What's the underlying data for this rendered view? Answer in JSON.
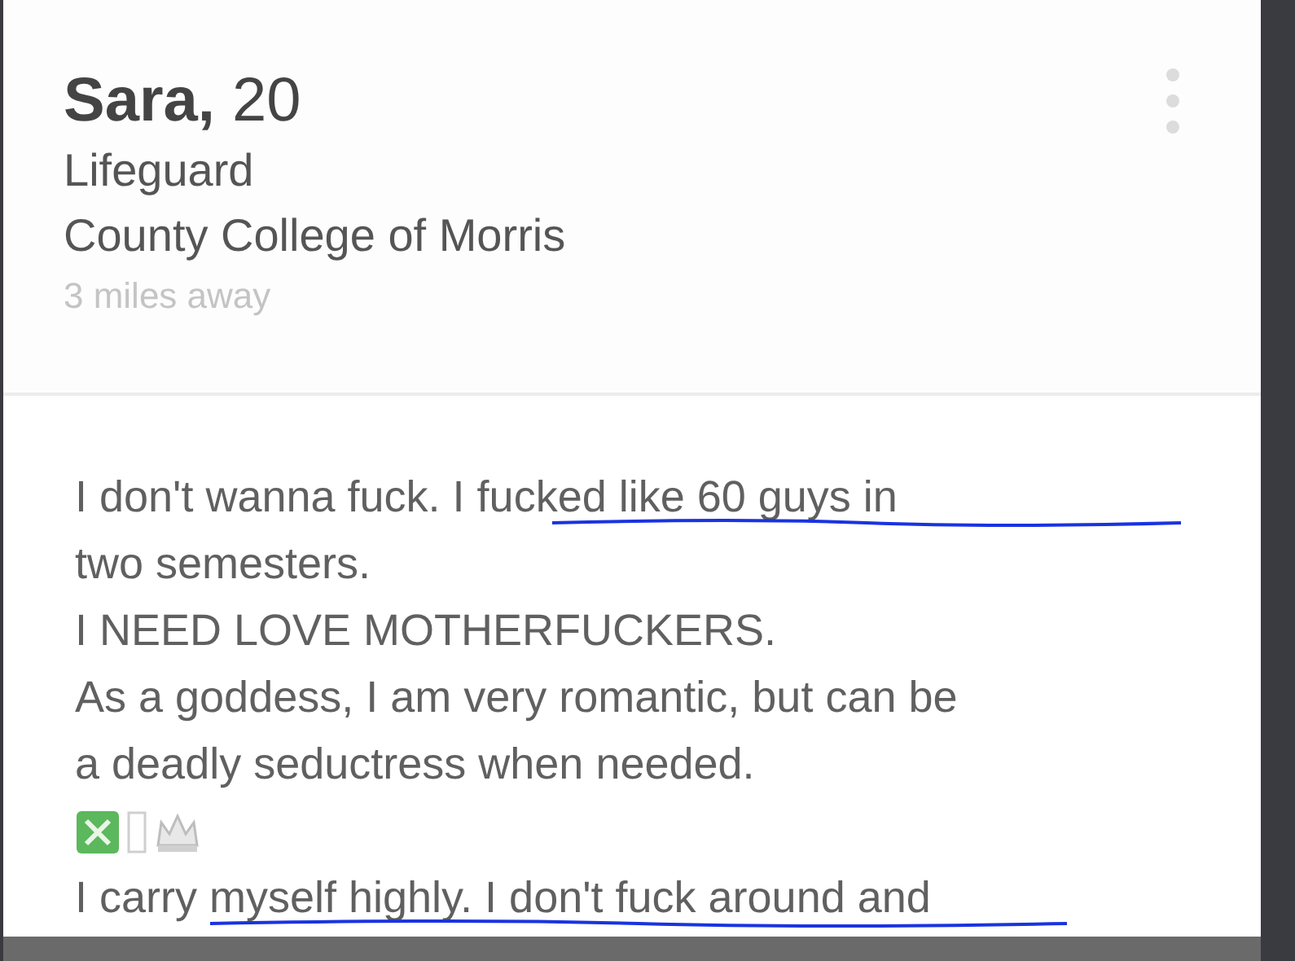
{
  "profile": {
    "name": "**Sara,** 20",
    "job": "Lifeguard",
    "school": "County College of Morris",
    "distance": "3 miles away"
  },
  "bio_lines": [
    "I don't wanna fuck. I fucked like 60 guys in",
    "two semesters.",
    "I NEED LOVE MOTHERFUCKERS.",
    "As a goddess, I am very romantic, but can be",
    "a deadly seductress when needed.",
    "I carry myself highly. I don't fuck around and"
  ]
}
